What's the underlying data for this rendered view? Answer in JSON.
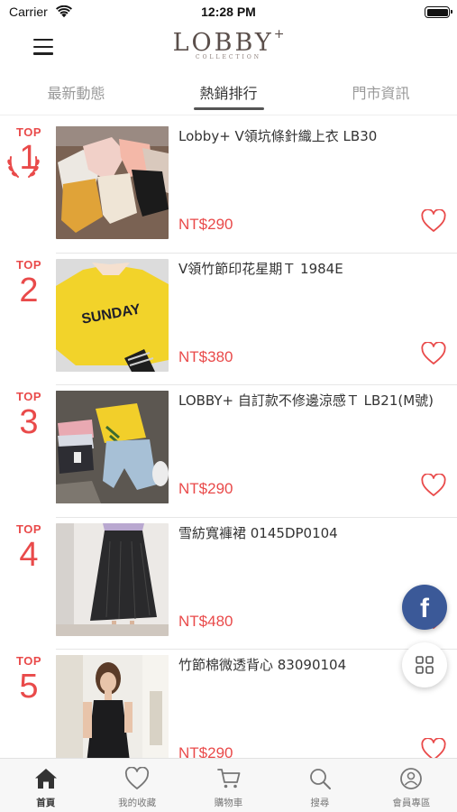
{
  "status_bar": {
    "carrier": "Carrier",
    "time": "12:28 PM"
  },
  "header": {
    "logo_text": "LOBBY",
    "logo_plus": "+",
    "logo_sub": "COLLECTION"
  },
  "tabs": [
    {
      "label": "最新動態",
      "active": false
    },
    {
      "label": "熱銷排行",
      "active": true
    },
    {
      "label": "門市資訊",
      "active": false
    }
  ],
  "products": [
    {
      "rank_label": "TOP",
      "rank": "1",
      "name": "Lobby+ V領坑條針織上衣 LB30",
      "price": "NT$290"
    },
    {
      "rank_label": "TOP",
      "rank": "2",
      "name": "V領竹節印花星期Ｔ 1984E",
      "price": "NT$380",
      "print_text": "SUNDAY"
    },
    {
      "rank_label": "TOP",
      "rank": "3",
      "name": "LOBBY+ 自訂款不修邊涼感Ｔ LB21(M號)",
      "price": "NT$290"
    },
    {
      "rank_label": "TOP",
      "rank": "4",
      "name": "雪紡寬褲裙 0145DP0104",
      "price": "NT$480"
    },
    {
      "rank_label": "TOP",
      "rank": "5",
      "name": "竹節棉微透背心 83090104",
      "price": "NT$290"
    }
  ],
  "fab": {
    "facebook_glyph": "f"
  },
  "bottom_nav": [
    {
      "label": "首頁",
      "icon": "home-icon",
      "active": true
    },
    {
      "label": "我的收藏",
      "icon": "heart-icon",
      "active": false
    },
    {
      "label": "購物車",
      "icon": "cart-icon",
      "active": false
    },
    {
      "label": "搜尋",
      "icon": "search-icon",
      "active": false
    },
    {
      "label": "會員專區",
      "icon": "member-icon",
      "active": false
    }
  ],
  "colors": {
    "accent": "#e94a4a",
    "facebook": "#3b5998",
    "logo": "#5a4e4a"
  }
}
